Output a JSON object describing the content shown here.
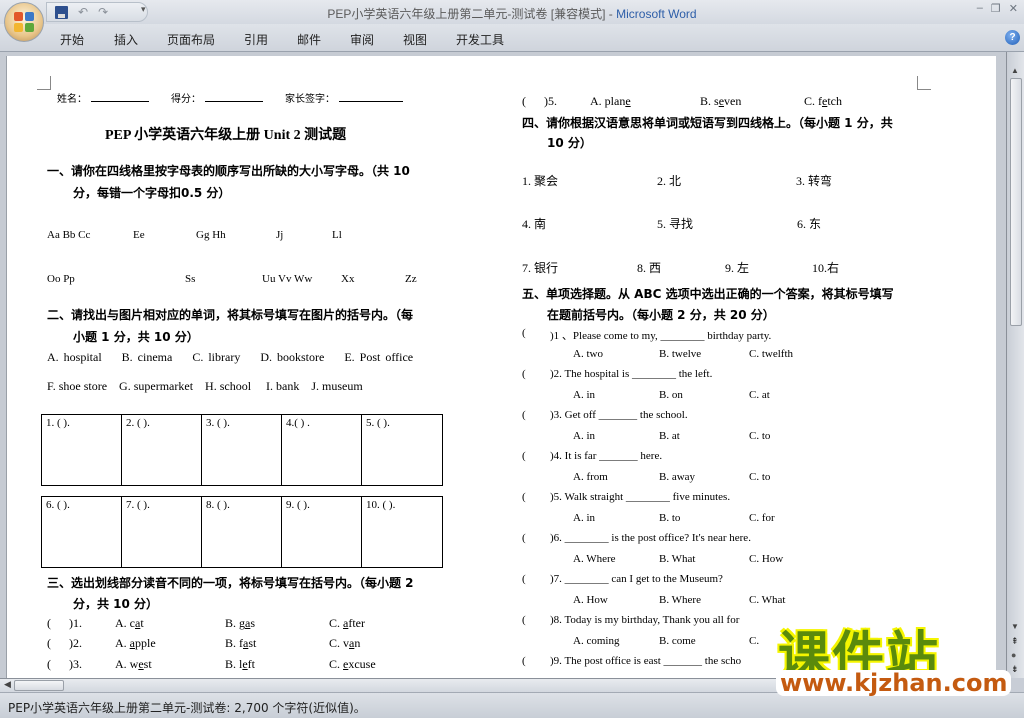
{
  "window": {
    "title": "PEP小学英语六年级上册第二单元-测试卷 [兼容模式]",
    "separator": " - ",
    "app_name": "Microsoft Word",
    "controls": {
      "minimize": "–",
      "restore": "❐",
      "close": "✕"
    }
  },
  "quick_access": {
    "save_icon": "save-icon",
    "undo": "↶",
    "redo": "↷",
    "customize": "▾"
  },
  "ribbon": {
    "tabs": [
      "开始",
      "插入",
      "页面布局",
      "引用",
      "邮件",
      "审阅",
      "视图",
      "开发工具"
    ],
    "help": "?"
  },
  "document": {
    "signature_line": {
      "name": "姓名：",
      "score": "得分：",
      "parent": "家长签字："
    },
    "title": "PEP 小学英语六年级上册 Unit 2  测试题",
    "section1": {
      "heading_line1": "一、请你在四线格里按字母表的顺序写出所缺的大小写字母。（共 10",
      "heading_line2": "分，每错一个字母扣0.5 分）",
      "row1": [
        "Aa Bb Cc",
        "Ee",
        "Gg Hh",
        "Jj",
        "Ll"
      ],
      "row2": [
        "Oo Pp",
        "Ss",
        "Uu Vv Ww",
        "Xx",
        "Zz"
      ]
    },
    "section2": {
      "heading_line1": "二、请找出与图片相对应的单词，将其标号填写在图片的括号内。（每",
      "heading_line2": "小题 1 分，共 10 分）",
      "options_row1": [
        "A. hospital",
        "B. cinema",
        "C. library",
        "D. bookstore",
        "E. Post office"
      ],
      "options_row2": [
        "F. shoe store",
        "G. supermarket",
        "H. school",
        "I. bank",
        "J. museum"
      ],
      "boxes_row1": [
        "1. (     ).",
        "2. (     ).",
        "3. (     ).",
        "4.(     ) .",
        "5. (     )."
      ],
      "boxes_row2": [
        "6. (       ).",
        "7. (     ).",
        "8. (     ).",
        "9. (     ).",
        "10. (     )."
      ]
    },
    "section3": {
      "heading_line1": "三、选出划线部分读音不同的一项，将标号填写在括号内。（每小题 2",
      "heading_line2": "分，共 10 分）",
      "items": [
        {
          "num": ")1.",
          "a": [
            "A. c",
            "a",
            "t"
          ],
          "b": [
            "B. g",
            "a",
            "s"
          ],
          "c": [
            "C. ",
            "a",
            "fter"
          ]
        },
        {
          "num": ")2.",
          "a": [
            "A. ",
            "a",
            "pple"
          ],
          "b": [
            "B. f",
            "a",
            "st"
          ],
          "c": [
            "C. v",
            "a",
            "n"
          ]
        },
        {
          "num": ")3.",
          "a": [
            "A. w",
            "e",
            "st"
          ],
          "b": [
            "B. l",
            "e",
            "ft"
          ],
          "c": [
            "C. ",
            "e",
            "xcuse"
          ]
        },
        {
          "num": ")5.",
          "a": [
            "A. plan",
            "e",
            ""
          ],
          "b": [
            "B. s",
            "e",
            "ven"
          ],
          "c": [
            "C. f",
            "e",
            "tch"
          ]
        }
      ]
    },
    "section4": {
      "heading_line1": "四、请你根据汉语意思将单词或短语写到四线格上。（每小题 1 分，共",
      "heading_line2": "10 分）",
      "row1": [
        "1. 聚会",
        "2. 北",
        "3. 转弯"
      ],
      "row2": [
        "4. 南",
        "5. 寻找",
        "6. 东"
      ],
      "row3": [
        "7. 银行",
        "8. 西",
        "9. 左",
        "10.右"
      ]
    },
    "section5": {
      "heading_line1": "五、单项选择题。从 ABC 选项中选出正确的一个答案，将其标号填写",
      "heading_line2": "在题前括号内。（每小题 2 分，共 20 分）",
      "questions": [
        {
          "q": ")1 、Please come to my, ________ birthday party.",
          "opts": [
            "A. two",
            "B. twelve",
            "C. twelfth"
          ]
        },
        {
          "q": ")2. The hospital is ________ the left.",
          "opts": [
            "A. in",
            "B. on",
            "C. at"
          ]
        },
        {
          "q": ")3. Get off _______ the school.",
          "opts": [
            "A. in",
            "B. at",
            "C. to"
          ]
        },
        {
          "q": ")4. It is far _______ here.",
          "opts": [
            "A. from",
            "B. away",
            "C. to"
          ]
        },
        {
          "q": ")5. Walk straight ________ five minutes.",
          "opts": [
            "A. in",
            "B. to",
            "C. for"
          ]
        },
        {
          "q": ")6. ________ is the post office? It's near here.",
          "opts": [
            "A. Where",
            "B. What",
            "C. How"
          ]
        },
        {
          "q": ")7. ________ can I get to the Museum?",
          "opts": [
            "A. How",
            "B. Where",
            "C. What"
          ]
        },
        {
          "q": ")8. Today is my birthday, Thank you all for",
          "opts": [
            "A. coming",
            "B. come",
            "C."
          ]
        },
        {
          "q": ")9. The post office is east _______ the scho",
          "opts": []
        }
      ]
    }
  },
  "watermark": {
    "cn": "课件站",
    "url": "www.kjzhan.com"
  },
  "status": {
    "text": "PEP小学英语六年级上册第二单元-测试卷: 2,700 个字符(近似值)。"
  }
}
